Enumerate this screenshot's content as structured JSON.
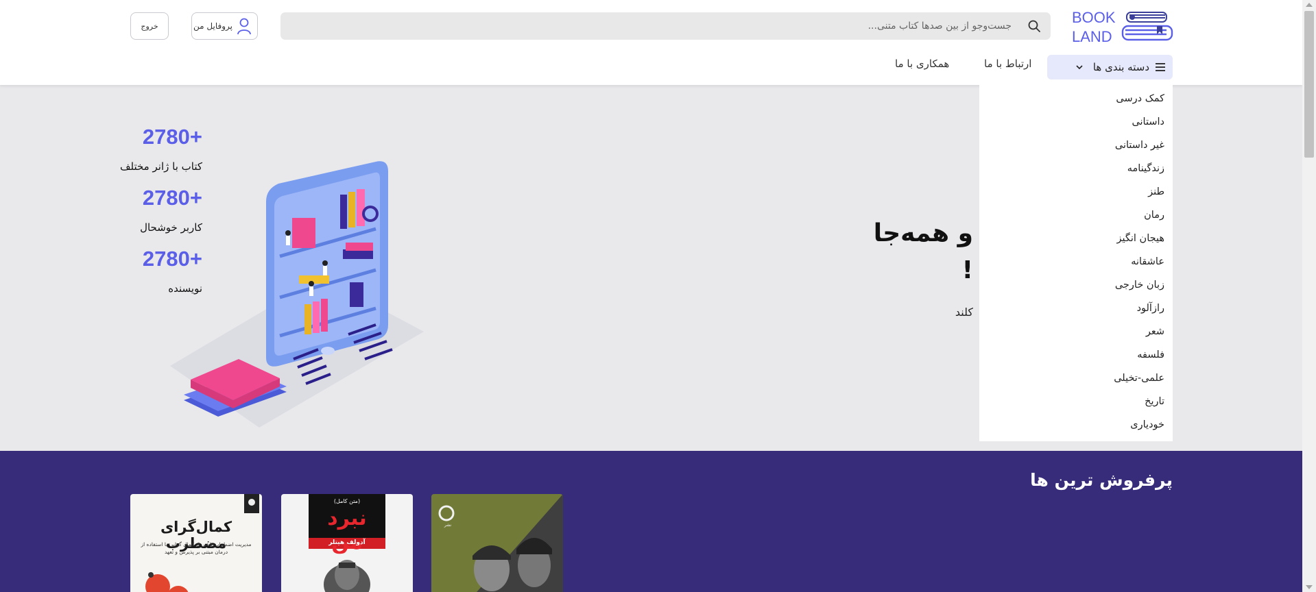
{
  "header": {
    "logo_line1": "BOOK",
    "logo_line2": "LAND",
    "search_placeholder": "جست‌وجو از بین صدها کتاب متنی...",
    "profile_label": "پروفایل من",
    "logout_label": "خروج"
  },
  "nav": {
    "categories_label": "دسته بندی ها",
    "contact_label": "ارتباط با ما",
    "collab_label": "همکاری با ما"
  },
  "dropdown": {
    "items": [
      "کمک درسی",
      "داستانی",
      "غیر داستانی",
      "زندگینامه",
      "طنز",
      "رمان",
      "هیجان انگیز",
      "عاشقانه",
      "زبان خارجی",
      "رازآلود",
      "شعر",
      "فلسفه",
      "علمی-تخیلی",
      "تاریخ",
      "خودیاری"
    ]
  },
  "hero": {
    "title_line1": "و همه‌جا",
    "title_line2": "!",
    "subtitle": "کلند",
    "stats": [
      {
        "value": "2780+",
        "label": "کتاب با ژانر مختلف"
      },
      {
        "value": "2780+",
        "label": "کاربر خوشحال"
      },
      {
        "value": "2780+",
        "label": "نویسنده"
      }
    ]
  },
  "bestsellers": {
    "title": "پرفروش ترین ها",
    "books": [
      {
        "title": "کمال‌گرای مضطرب",
        "subtitle": "مدیریت اضطراب ناشی از کمال گرایی با استفاده از درمان مبتنی بر پذیرش و تعهد"
      },
      {
        "title": "نبرد من",
        "author": "آدولف هیتلر",
        "badge": "(متن کامل)"
      },
      {
        "title": "",
        "publisher": "نشر"
      }
    ]
  },
  "colors": {
    "brand": "#5b5fe8",
    "bestsellers_bg": "#372c7a",
    "hero_bg": "#e9e9ec",
    "nav_active_bg": "#e6e8fb"
  },
  "icons": [
    "logo-book-icon",
    "search-icon",
    "user-icon",
    "menu-icon",
    "chevron-down-icon"
  ]
}
